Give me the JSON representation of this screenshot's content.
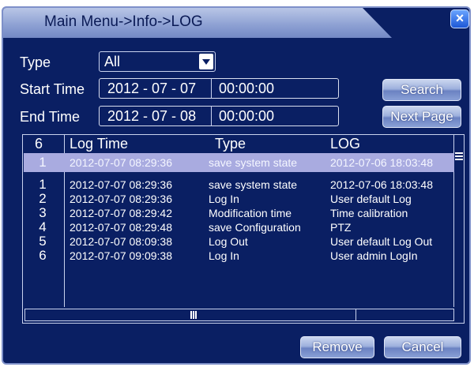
{
  "window": {
    "title": "Main Menu->Info->LOG",
    "close_glyph": "×"
  },
  "filter": {
    "type_label": "Type",
    "type_value": "All",
    "start_label": "Start Time",
    "start_date": "2012 - 07 - 07",
    "start_time": "00:00:00",
    "end_label": "End Time",
    "end_date": "2012 - 07 - 08",
    "end_time": "00:00:00"
  },
  "buttons": {
    "search": "Search",
    "next_page": "Next Page",
    "remove": "Remove",
    "cancel": "Cancel"
  },
  "table": {
    "headers": {
      "count": "6",
      "time": "Log Time",
      "type": "Type",
      "log": "LOG"
    },
    "selected_row": {
      "num": "1",
      "time": "2012-07-07 08:29:36",
      "type": "save system state",
      "log": "2012-07-06 18:03:48"
    },
    "rows": [
      {
        "num": "1",
        "time": "2012-07-07 08:29:36",
        "type": "save system state",
        "log": "2012-07-06 18:03:48"
      },
      {
        "num": "2",
        "time": "2012-07-07 08:29:36",
        "type": "Log In",
        "log": "User default Log"
      },
      {
        "num": "3",
        "time": "2012-07-07 08:29:42",
        "type": "Modification time",
        "log": "Time calibration"
      },
      {
        "num": "4",
        "time": "2012-07-07 08:29:48",
        "type": "save Configuration",
        "log": "PTZ"
      },
      {
        "num": "5",
        "time": "2012-07-07 08:09:38",
        "type": "Log Out",
        "log": "User default Log Out"
      },
      {
        "num": "6",
        "time": "2012-07-07 09:09:38",
        "type": "Log In",
        "log": "User admin LogIn"
      }
    ]
  }
}
